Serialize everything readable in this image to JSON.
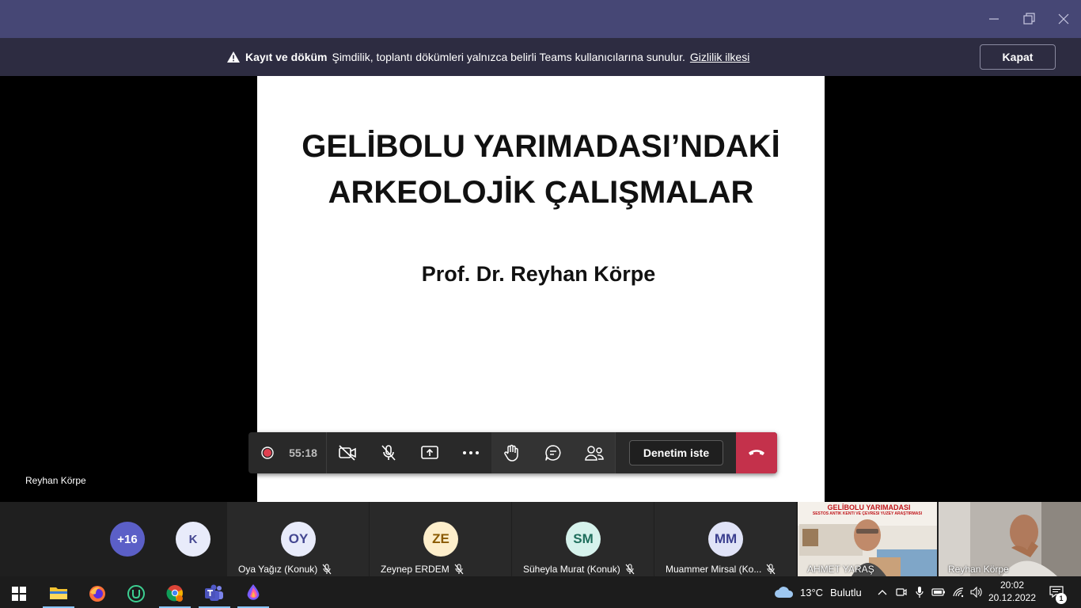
{
  "notification": {
    "bold_text": "Kayıt ve döküm",
    "message": "Şimdilik, toplantı dökümleri yalnızca belirli Teams kullanıcılarına sunulur.",
    "link": "Gizlilik ilkesi",
    "close_label": "Kapat"
  },
  "slide": {
    "title_line1": "GELİBOLU YARIMADASI’NDAKİ",
    "title_line2": "ARKEOLOJİK ÇALIŞMALAR",
    "author": "Prof. Dr. Reyhan Körpe"
  },
  "stage": {
    "presenter_name": "Reyhan Körpe"
  },
  "controls": {
    "timer": "55:18",
    "request_control_label": "Denetim iste"
  },
  "participants": {
    "overflow": "+16",
    "single": "K",
    "tiles": [
      {
        "initials": "OY",
        "name": "Oya Yağız (Konuk)",
        "color": "#e8ebfa"
      },
      {
        "initials": "ZE",
        "name": "Zeynep ERDEM",
        "color": "#fdeecb"
      },
      {
        "initials": "SM",
        "name": "Süheyla Murat (Konuk)",
        "color": "#d6f2ec"
      },
      {
        "initials": "MM",
        "name": "Muammer Mirsal (Ko...",
        "color": "#e0e3f7"
      }
    ],
    "video": [
      {
        "name": "AHMET YARAŞ",
        "poster_title": "GELİBOLU YARIMADASI",
        "poster_sub": "SESTOS ANTİK KENTİ VE ÇEVRESİ YÜZEY ARAŞTIRMASI"
      },
      {
        "name": "Reyhan Körpe"
      }
    ]
  },
  "taskbar": {
    "weather_temp": "13°C",
    "weather_desc": "Bulutlu",
    "time": "20:02",
    "date": "20.12.2022",
    "notification_count": "1"
  }
}
